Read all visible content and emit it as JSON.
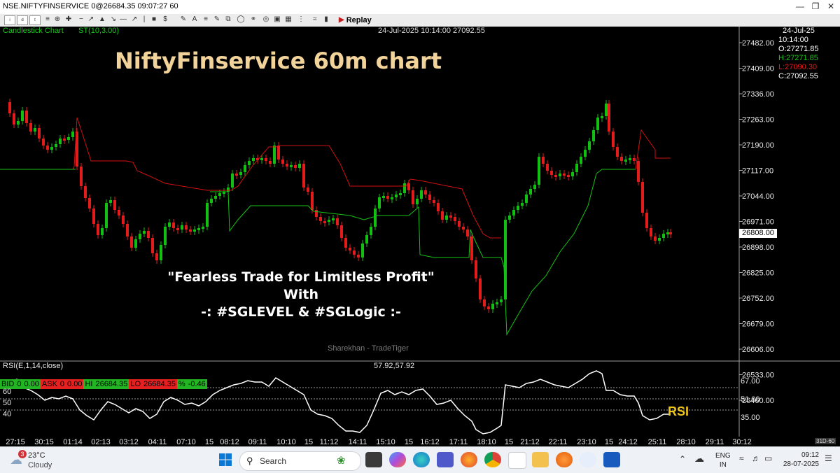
{
  "window": {
    "title": "NSE.NIFTYFINSERVICE 0@26684.35 09:07:27 60"
  },
  "toolbar": {
    "replay_label": "Replay"
  },
  "chart": {
    "type_label": "Candlestick Chart",
    "indicator_label": "ST(10,3.00)",
    "cursor_info": "24-Jul-2025 10:14:00 27092.55",
    "overlay_title": "NiftyFinservice 60m chart",
    "tagline_1": "\"Fearless Trade for Limitless Profit\"",
    "tagline_2": "With",
    "tagline_3": "-: #SGLEVEL & #SGLogic :-",
    "watermark": "Sharekhan - TradeTiger",
    "current_price_tag": "26808.00",
    "price_axis": [
      "27482.00",
      "27409.00",
      "27336.00",
      "27263.00",
      "27190.00",
      "27117.00",
      "27044.00",
      "26971.00",
      "26898.00",
      "26825.00",
      "26752.00",
      "26679.00",
      "26606.00",
      "26533.00",
      "26460.00"
    ],
    "ohlc": {
      "date": "24-Jul-25",
      "time": "10:14:00",
      "open": "O:27271.85",
      "high": "H:27271.85",
      "low": "L:27090.30",
      "close": "C:27092.55"
    },
    "colors": {
      "up": "#11c011",
      "down": "#e41b1b",
      "supertrend_up": "#15c415",
      "supertrend_down": "#d21010",
      "title": "#f2d39a",
      "rsi_label": "#f0c419"
    }
  },
  "quote_bar": {
    "bid_label": "BID",
    "bid_value": "0",
    "bid_qty": "0.00",
    "ask_label": "ASK",
    "ask_value": "0",
    "ask_qty": "0.00",
    "hi_label": "HI",
    "hi_value": "26684.35",
    "lo_label": "LO",
    "lo_value": "26684.35",
    "pct_label": "%",
    "pct_value": "-0.46"
  },
  "rsi_panel": {
    "indicator_label": "RSI(E,1,14,close)",
    "values_readout": "57.92,57.92",
    "axis_right": [
      "67.00",
      "51.00",
      "35.00"
    ],
    "axis_left": [
      "60",
      "50",
      "40"
    ],
    "tag": "RSI"
  },
  "time_axis": {
    "labels": [
      "27:15",
      "30:15",
      "01:14",
      "02:13",
      "03:12",
      "04:11",
      "07:10",
      "15",
      "08:12",
      "09:11",
      "10:10",
      "15",
      "11:12",
      "14:11",
      "15:10",
      "15",
      "16:12",
      "17:11",
      "18:10",
      "15",
      "21:12",
      "22:11",
      "23:10",
      "15",
      "24:12",
      "25:11",
      "28:10",
      "29:11",
      "30:12"
    ],
    "corner": "31D-60"
  },
  "taskbar": {
    "weather_temp": "23°C",
    "weather_desc": "Cloudy",
    "weather_badge": "3",
    "search_placeholder": "Search",
    "lang_1": "ENG",
    "lang_2": "IN",
    "time": "09:12",
    "date": "28-07-2025"
  }
}
